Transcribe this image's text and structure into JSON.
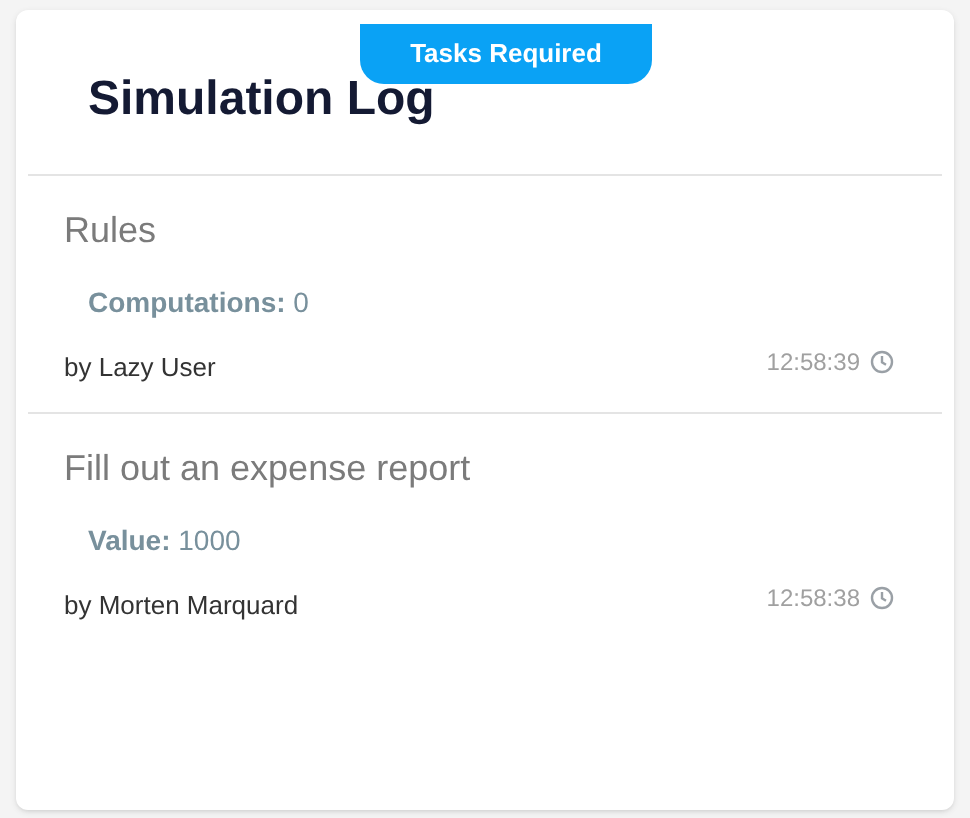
{
  "badge": "Tasks Required",
  "title": "Simulation Log",
  "entries": [
    {
      "title": "Rules",
      "property": {
        "label": "Computations:",
        "value": "0"
      },
      "author": "by Lazy User",
      "time": "12:58:39"
    },
    {
      "title": "Fill out an expense report",
      "property": {
        "label": "Value:",
        "value": "1000"
      },
      "author": "by Morten Marquard",
      "time": "12:58:38"
    }
  ]
}
